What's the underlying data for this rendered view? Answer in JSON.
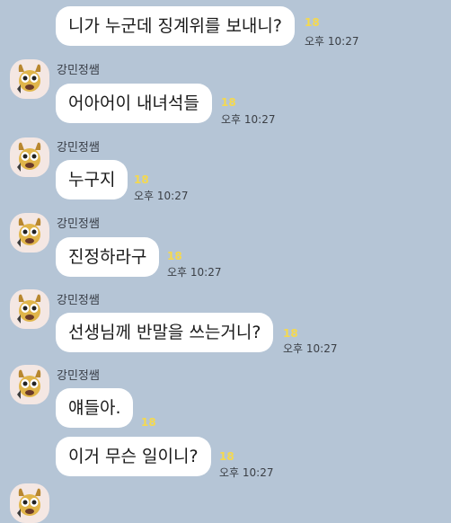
{
  "sender_name": "강민정쌤",
  "messages": [
    {
      "text": "니가 누군데 징계위를 보내니?",
      "unread": "18",
      "time": "오후 10:27"
    },
    {
      "text": "어아어이 내녀석들",
      "unread": "18",
      "time": "오후 10:27"
    },
    {
      "text": "누구지",
      "unread": "18",
      "time": "오후 10:27"
    },
    {
      "text": "진정하라구",
      "unread": "18",
      "time": "오후 10:27"
    },
    {
      "text": "선생님께 반말을 쓰는거니?",
      "unread": "18",
      "time": "오후 10:27"
    },
    {
      "text": "얘들아.",
      "unread": "18"
    },
    {
      "text": "이거 무슨 일이니?",
      "unread": "18",
      "time": "오후 10:27"
    }
  ]
}
